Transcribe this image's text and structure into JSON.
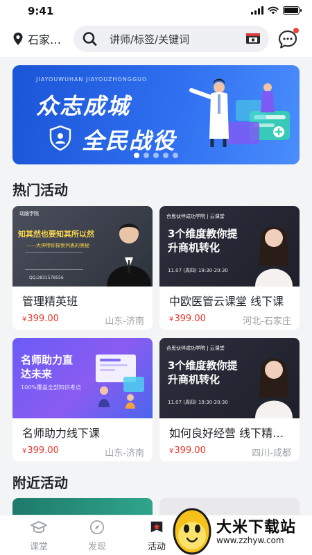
{
  "status_bar": {
    "time": "9:41"
  },
  "header": {
    "location": "石家…",
    "search_placeholder": "讲师/标签/关键词"
  },
  "banner": {
    "subtitle": "JIAYOUWUHAN JIAYOUZHONGGUO",
    "line1": "众志成城",
    "line2": "全民战役",
    "dot_count": 5,
    "active_dot": 0
  },
  "hot_section": {
    "title": "热门活动"
  },
  "hot_activities": [
    {
      "title": "管理精英班",
      "price": "399.00",
      "location": "山东-济南",
      "img": {
        "brand": "动脑学院",
        "headline": "知其然也要知其所以然",
        "sub": "——大神带你探索列表的奥秘",
        "date": "QQ:2831578556"
      }
    },
    {
      "title": "中欧医管云课堂 线下课",
      "price": "399.00",
      "location": "河北-石家庄",
      "img": {
        "brand": "合思伙伴成功学院 | 云课堂",
        "headline": "3个维度教你提升商机转化",
        "date": "11.07 (周四) 19:30-20:30"
      }
    },
    {
      "title": "名师助力线下课",
      "price": "399.00",
      "location": "山东-济南",
      "img": {
        "headline": "名师助力直达未来",
        "sub": "100%覆盖全部知识考点"
      }
    },
    {
      "title": "如何良好经营 线下精…",
      "price": "399.00",
      "location": "四川-成都",
      "img": {
        "brand": "合思伙伴成功学院 | 云课堂",
        "headline": "3个维度教你提升商机转化",
        "date": "11.07 (周四) 19:30-20:30"
      }
    }
  ],
  "nearby_section": {
    "title": "附近活动"
  },
  "price_symbol": "¥",
  "tabs": [
    {
      "label": "课堂",
      "icon": "graduation-cap-icon",
      "active": false
    },
    {
      "label": "发现",
      "icon": "compass-icon",
      "active": false
    },
    {
      "label": "活动",
      "icon": "star-badge-icon",
      "active": true
    }
  ],
  "watermark": {
    "text": "大米下载站",
    "url": "www.zzhyw.com"
  },
  "colors": {
    "price": "#e8352b",
    "banner": "#2f6ff0",
    "accent": "#e8352b"
  }
}
